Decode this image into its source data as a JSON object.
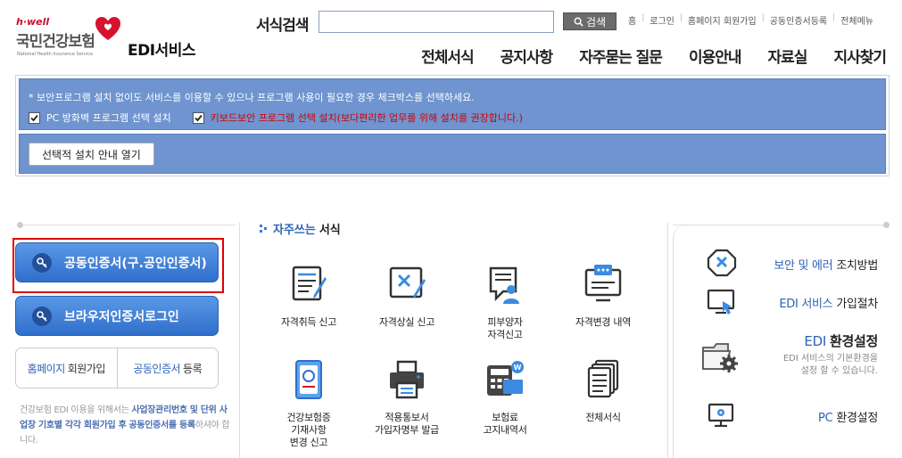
{
  "header": {
    "logo": {
      "brand_small": "h·well",
      "org_name": "국민건강보험",
      "org_name_en": "National Health Insurance Service",
      "service_name": "EDI서비스"
    },
    "search": {
      "label": "서식검색",
      "placeholder": "",
      "button_label": "검색"
    },
    "top_links": [
      "홈",
      "로그인",
      "홈페이지 회원가입",
      "공동인증서등록",
      "전체메뉴"
    ],
    "nav": [
      "전체서식",
      "공지사항",
      "자주묻는 질문",
      "이용안내",
      "자료실",
      "지사찾기"
    ]
  },
  "notice": {
    "message": "* 보안프로그램 설치 없이도 서비스를 이용할 수 있으나 프로그램 사용이 필요한 경우 체크박스를 선택하세요.",
    "checkbox1_label": "PC 방화벽 프로그램 선택 설치",
    "checkbox2_label": "키보드보안 프로그램 선택 설치(보다편리한 업무를 위해 설치를 권장합니다.)",
    "guide_button": "선택적 설치 안내 열기"
  },
  "login": {
    "cert_button": "공동인증서(구.공인인증서)",
    "browser_cert_button": "브라우저인증서로그인",
    "signup_highlight": "홈페이지",
    "signup_rest": "회원가입",
    "cert_reg_highlight": "공동인증서",
    "cert_reg_rest": "등록",
    "desc_1": "건강보험 EDI 이용을 위해서는 ",
    "desc_b1": "사업장관리번호",
    "desc_2": " ",
    "desc_b2": "및 단위 사업장 기호별 각각 회원가입 후",
    "desc_3": " ",
    "desc_b3": "공동인증서를 등록",
    "desc_4": "하셔야 합니다."
  },
  "frequent": {
    "title_highlight": "자주쓰는",
    "title_rest": "서식",
    "items": [
      {
        "line1": "자격취득 신고",
        "line2": "",
        "line3": ""
      },
      {
        "line1": "자격상실 신고",
        "line2": "",
        "line3": ""
      },
      {
        "line1": "피부양자",
        "line2": "자격신고",
        "line3": ""
      },
      {
        "line1": "자격변경 내역",
        "line2": "",
        "line3": ""
      },
      {
        "line1": "건강보험증",
        "line2": "기재사항",
        "line3": "변경 신고"
      },
      {
        "line1": "적용통보서",
        "line2": "가입자명부 발급",
        "line3": ""
      },
      {
        "line1": "보험료",
        "line2": "고지내역서",
        "line3": ""
      },
      {
        "line1": "전체서식",
        "line2": "",
        "line3": ""
      }
    ]
  },
  "side": {
    "security_highlight": "보안 및 에러",
    "security_rest": "조치방법",
    "signup_highlight": "EDI 서비스",
    "signup_rest": "가입절차",
    "env_highlight": "EDI",
    "env_rest": "환경설정",
    "env_sub1": "EDI 서비스의 기본환경을",
    "env_sub2": "설정 할 수 있습니다.",
    "pc_highlight": "PC",
    "pc_rest": "환경설정"
  },
  "colors": {
    "notice_bg": "#6f94cf",
    "button_blue": "#2f6fcb",
    "highlight_text": "#2c63b8",
    "warning_red": "#d40000"
  }
}
